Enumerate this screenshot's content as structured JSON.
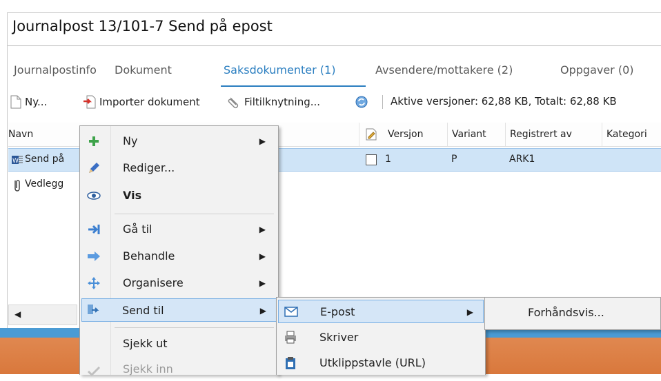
{
  "window": {
    "title": "Journalpost 13/101-7 Send på epost"
  },
  "tabs": [
    {
      "label": "Journalpostinfo",
      "active": false
    },
    {
      "label": "Dokument",
      "active": false
    },
    {
      "label": "Saksdokumenter (1)",
      "active": true
    },
    {
      "label": "Avsendere/mottakere (2)",
      "active": false
    },
    {
      "label": "Oppgaver (0)",
      "active": false
    }
  ],
  "toolbar": {
    "new_label": "Ny...",
    "import_label": "Importer dokument",
    "attach_label": "Filtilknytning...",
    "status_text": "Aktive versjoner: 62,88 KB,  Totalt: 62,88 KB"
  },
  "grid": {
    "columns": [
      "Navn",
      "Versjon",
      "Variant",
      "Registrert av",
      "Kategori"
    ],
    "rows": [
      {
        "name": "Send på",
        "version": "1",
        "variant": "P",
        "registered_by": "ARK1",
        "selected": true
      },
      {
        "name": "Vedlegg",
        "version": "",
        "variant": "",
        "registered_by": "",
        "selected": false
      }
    ]
  },
  "context_menu": {
    "items": [
      {
        "label": "Ny",
        "icon": "plus-icon",
        "submenu": true,
        "bold": false
      },
      {
        "label": "Rediger...",
        "icon": "pencil-icon",
        "submenu": false,
        "bold": false
      },
      {
        "label": "Vis",
        "icon": "eye-icon",
        "submenu": false,
        "bold": true
      },
      {
        "label": "Gå til",
        "icon": "goto-arrow-icon",
        "submenu": true,
        "bold": false
      },
      {
        "label": "Behandle",
        "icon": "process-arrow-icon",
        "submenu": true,
        "bold": false
      },
      {
        "label": "Organisere",
        "icon": "move-cross-icon",
        "submenu": true,
        "bold": false
      },
      {
        "label": "Send til",
        "icon": "send-to-icon",
        "submenu": true,
        "bold": false,
        "highlighted": true
      },
      {
        "label": "Sjekk ut",
        "icon": "",
        "submenu": false,
        "bold": false
      },
      {
        "label": "Sjekk inn",
        "icon": "checkmark-icon",
        "submenu": false,
        "bold": false,
        "disabled": true
      }
    ]
  },
  "send_submenu": {
    "items": [
      {
        "label": "E-post",
        "icon": "envelope-icon",
        "submenu": true,
        "highlighted": true
      },
      {
        "label": "Skriver",
        "icon": "printer-icon",
        "submenu": false
      },
      {
        "label": "Utklippstavle (URL)",
        "icon": "clipboard-icon",
        "submenu": false
      }
    ]
  },
  "email_submenu": {
    "items": [
      {
        "label": "Forhåndsvis..."
      }
    ]
  },
  "colors": {
    "accent": "#2a7ec0",
    "selection": "#cfe4f7",
    "menu_highlight": "#d5e6f7"
  }
}
